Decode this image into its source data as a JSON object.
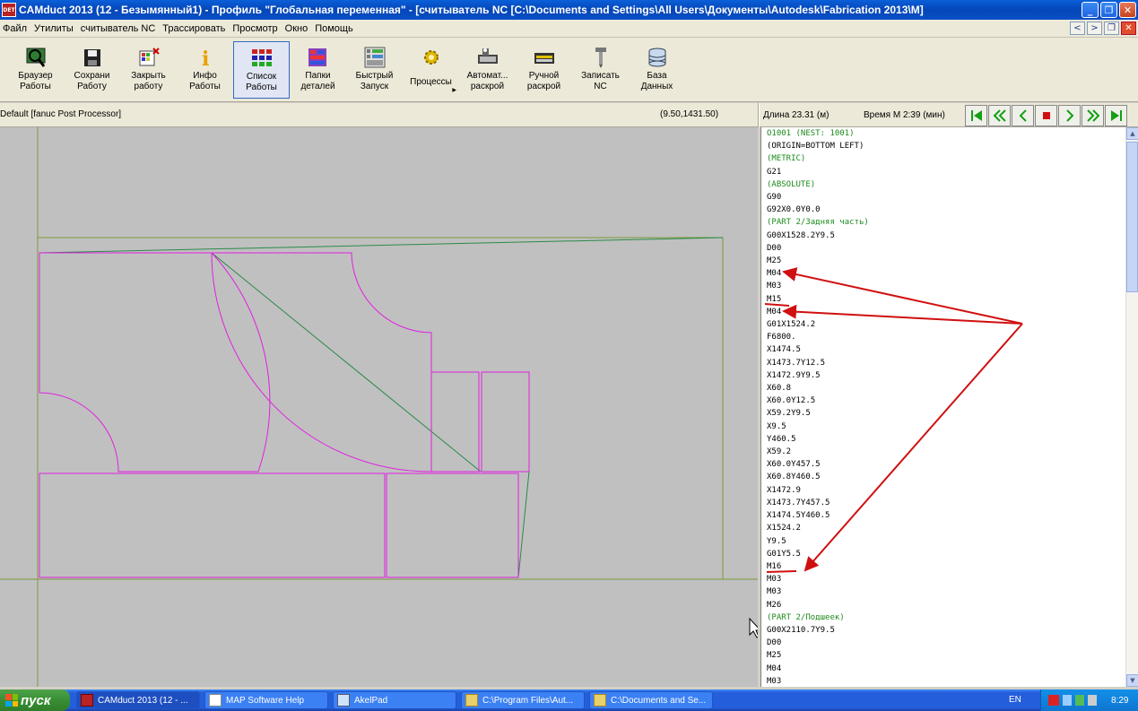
{
  "window": {
    "title": "CAMduct 2013 (12 - Безымянный1) - Профиль \"Глобальная переменная\" - [считыватель NC [C:\\Documents and Settings\\All Users\\Документы\\Autodesk\\Fabrication 2013\\M]",
    "app_icon_text": "DET",
    "minimize": "_",
    "restore": "❐",
    "close": "✕"
  },
  "menu": [
    "Файл",
    "Утилиты",
    "считыватель NC",
    "Трассировать",
    "Просмотр",
    "Окно",
    "Помощь"
  ],
  "mdi": {
    "left": "<",
    "right": ">",
    "restore": "❐",
    "close": "✕"
  },
  "toolbar": [
    {
      "label": "Браузер\nРаботы",
      "icon": "job-browser-icon"
    },
    {
      "label": "Сохрани\nРаботу",
      "icon": "save-icon"
    },
    {
      "label": "Закрыть\nработу",
      "icon": "close-job-icon"
    },
    {
      "label": "Инфо\nРаботы",
      "icon": "info-icon"
    },
    {
      "label": "Список\nРаботы",
      "icon": "job-list-icon",
      "active": true
    },
    {
      "label": "Папки\nдеталей",
      "icon": "part-folders-icon"
    },
    {
      "label": "Быстрый\nЗапуск",
      "icon": "quick-launch-icon"
    },
    {
      "label": "Процессы",
      "icon": "processes-icon",
      "dropdown": true
    },
    {
      "label": "Автомат...\nраскрой",
      "icon": "auto-nest-icon"
    },
    {
      "label": "Ручной\nраскрой",
      "icon": "manual-nest-icon"
    },
    {
      "label": "Записать\nNC",
      "icon": "write-nc-icon"
    },
    {
      "label": "База\nДанных",
      "icon": "database-icon"
    }
  ],
  "infobar": {
    "post_processor": "Default [fanuc Post Processor]",
    "coordinates": "(9.50,1431.50)",
    "length": "Длина 23.31 (м)",
    "time": "Время М 2:39 (мин)"
  },
  "nc_code": [
    {
      "text": "O1001 (NEST: 1001)",
      "comment": true
    },
    {
      "text": "(ORIGIN=BOTTOM LEFT)",
      "comment": false
    },
    {
      "text": "(METRIC)",
      "comment": true
    },
    {
      "text": "G21",
      "comment": false
    },
    {
      "text": "(ABSOLUTE)",
      "comment": true
    },
    {
      "text": "G90",
      "comment": false
    },
    {
      "text": "G92X0.0Y0.0",
      "comment": false
    },
    {
      "text": "(PART 2/Задняя часть)",
      "comment": true
    },
    {
      "text": "G00X1528.2Y9.5",
      "comment": false
    },
    {
      "text": "D00",
      "comment": false
    },
    {
      "text": "M25",
      "comment": false
    },
    {
      "text": "M04",
      "comment": false
    },
    {
      "text": "M03",
      "comment": false
    },
    {
      "text": "M15",
      "comment": false
    },
    {
      "text": "M04",
      "comment": false
    },
    {
      "text": "G01X1524.2",
      "comment": false
    },
    {
      "text": "F6800.",
      "comment": false
    },
    {
      "text": "X1474.5",
      "comment": false
    },
    {
      "text": "X1473.7Y12.5",
      "comment": false
    },
    {
      "text": "X1472.9Y9.5",
      "comment": false
    },
    {
      "text": "X60.8",
      "comment": false
    },
    {
      "text": "X60.0Y12.5",
      "comment": false
    },
    {
      "text": "X59.2Y9.5",
      "comment": false
    },
    {
      "text": "X9.5",
      "comment": false
    },
    {
      "text": "Y460.5",
      "comment": false
    },
    {
      "text": "X59.2",
      "comment": false
    },
    {
      "text": "X60.0Y457.5",
      "comment": false
    },
    {
      "text": "X60.8Y460.5",
      "comment": false
    },
    {
      "text": "X1472.9",
      "comment": false
    },
    {
      "text": "X1473.7Y457.5",
      "comment": false
    },
    {
      "text": "X1474.5Y460.5",
      "comment": false
    },
    {
      "text": "X1524.2",
      "comment": false
    },
    {
      "text": "Y9.5",
      "comment": false
    },
    {
      "text": "G01Y5.5",
      "comment": false
    },
    {
      "text": "M16",
      "comment": false
    },
    {
      "text": "M03",
      "comment": false
    },
    {
      "text": "M03",
      "comment": false
    },
    {
      "text": "M26",
      "comment": false
    },
    {
      "text": "(PART 2/Подшеек)",
      "comment": true
    },
    {
      "text": "G00X2110.7Y9.5",
      "comment": false
    },
    {
      "text": "D00",
      "comment": false
    },
    {
      "text": "M25",
      "comment": false
    },
    {
      "text": "M04",
      "comment": false
    },
    {
      "text": "M03",
      "comment": false
    }
  ],
  "taskbar": {
    "start": "пуск",
    "tasks": [
      {
        "label": "CAMduct 2013 (12 - ...",
        "active": true
      },
      {
        "label": "MAP Software Help",
        "active": false
      },
      {
        "label": "AkelPad",
        "active": false
      },
      {
        "label": "C:\\Program Files\\Aut...",
        "active": false
      },
      {
        "label": "C:\\Documents and Se...",
        "active": false
      }
    ],
    "language": "EN",
    "clock": "8:29"
  },
  "colors": {
    "part_outline": "#e020e0",
    "sheet_outline": "#6a8a30",
    "toolpath": "#2a8a4a",
    "annotation_arrow": "#d01010",
    "nc_comment": "#1c8a1c"
  }
}
